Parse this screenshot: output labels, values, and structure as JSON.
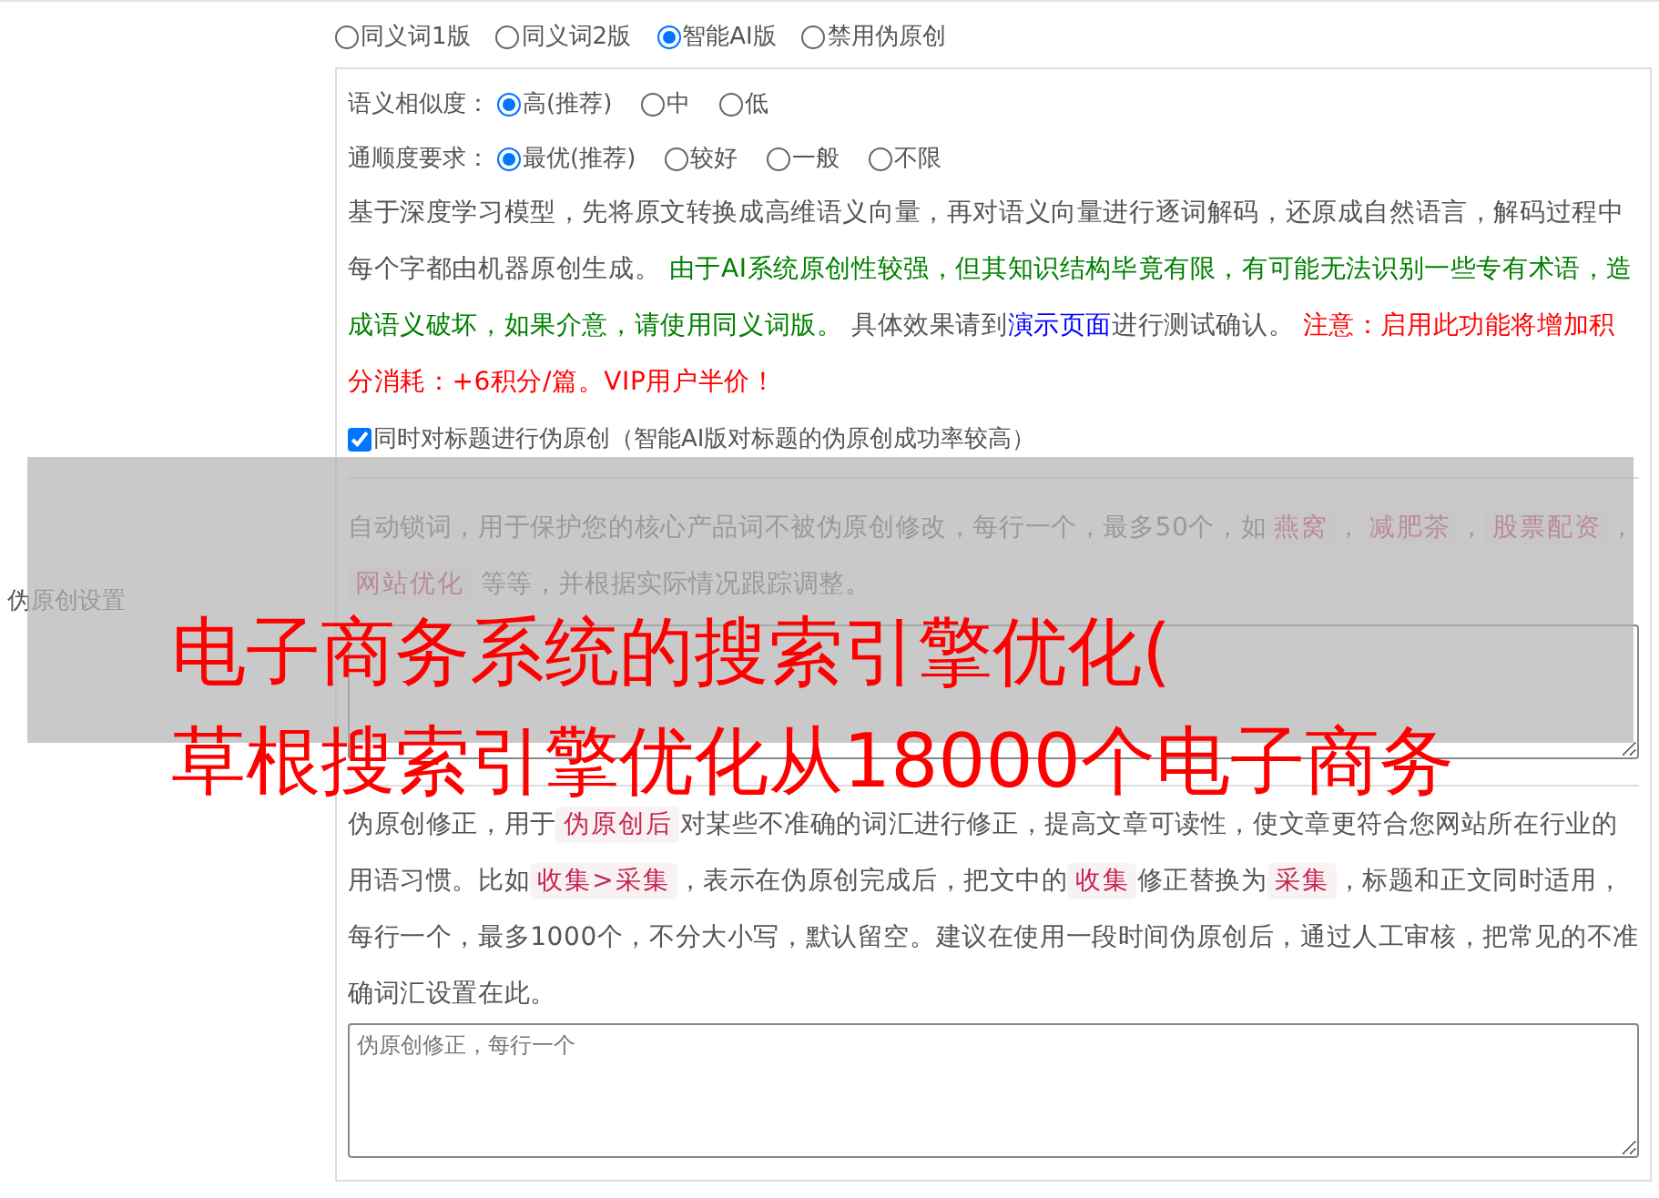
{
  "side_label": "伪原创设置",
  "modes": [
    {
      "label": "同义词1版",
      "selected": false
    },
    {
      "label": "同义词2版",
      "selected": false
    },
    {
      "label": "智能AI版",
      "selected": true
    },
    {
      "label": "禁用伪原创",
      "selected": false
    }
  ],
  "ai_settings": {
    "option_groups": [
      {
        "label": "语义相似度：",
        "options": [
          {
            "label": "高(推荐)",
            "selected": true
          },
          {
            "label": "中",
            "selected": false
          },
          {
            "label": "低",
            "selected": false
          }
        ]
      },
      {
        "label": "通顺度要求：",
        "options": [
          {
            "label": "最优(推荐)",
            "selected": true
          },
          {
            "label": "较好",
            "selected": false
          },
          {
            "label": "一般",
            "selected": false
          },
          {
            "label": "不限",
            "selected": false
          }
        ]
      }
    ],
    "description": [
      {
        "kind": "plain",
        "text": "基于深度学习模型，先将原文转换成高维语义向量，再对语义向量进行逐词解码，还原成自然语言，解码过程中每个字都由机器原创生成。 "
      },
      {
        "kind": "green",
        "text": "由于AI系统原创性较强，但其知识结构毕竟有限，有可能无法识别一些专有术语，造成语义破坏，如果介意，请使用同义词版。"
      },
      {
        "kind": "plain",
        "text": " 具体效果请到"
      },
      {
        "kind": "link",
        "text": "演示页面"
      },
      {
        "kind": "plain",
        "text": "进行测试确认。 "
      },
      {
        "kind": "red",
        "text": "注意：启用此功能将增加积分消耗：+6积分/篇。VIP用户半价！"
      }
    ],
    "title_checkbox": {
      "label": "同时对标题进行伪原创（智能AI版对标题的伪原创成功率较高）",
      "checked": true
    }
  },
  "lock_words": {
    "description": [
      {
        "kind": "plain",
        "text": "自动锁词，用于保护您的核心产品词不被伪原创修改，每行一个，最多50个，如"
      },
      {
        "kind": "tag",
        "text": "燕窝"
      },
      {
        "kind": "plain",
        "text": "，"
      },
      {
        "kind": "tag",
        "text": "减肥茶"
      },
      {
        "kind": "plain",
        "text": "，"
      },
      {
        "kind": "tag",
        "text": "股票配资"
      },
      {
        "kind": "plain",
        "text": "，"
      },
      {
        "kind": "tag",
        "text": "网站优化"
      },
      {
        "kind": "plain",
        "text": " 等等，并根据实际情况跟踪调整。"
      }
    ]
  },
  "correction": {
    "description": [
      {
        "kind": "plain",
        "text": "伪原创修正，用于"
      },
      {
        "kind": "tag",
        "text": "伪原创后"
      },
      {
        "kind": "plain",
        "text": "对某些不准确的词汇进行修正，提高文章可读性，使文章更符合您网站所在行业的用语习惯。比如"
      },
      {
        "kind": "tag",
        "text": "收集>采集"
      },
      {
        "kind": "plain",
        "text": "，表示在伪原创完成后，把文中的"
      },
      {
        "kind": "tag",
        "text": "收集"
      },
      {
        "kind": "plain",
        "text": "修正替换为"
      },
      {
        "kind": "tag",
        "text": "采集"
      },
      {
        "kind": "plain",
        "text": "，标题和正文同时适用，每行一个，最多1000个，不分大小写，默认留空。建议在使用一段时间伪原创后，通过人工审核，把常见的不准确词汇设置在此。"
      }
    ],
    "input": {
      "placeholder": "伪原创修正，每行一个"
    }
  },
  "overlay_title": [
    "电子商务系统的搜索引擎优化(",
    "草根搜索引擎优化从18000个电子商务"
  ]
}
